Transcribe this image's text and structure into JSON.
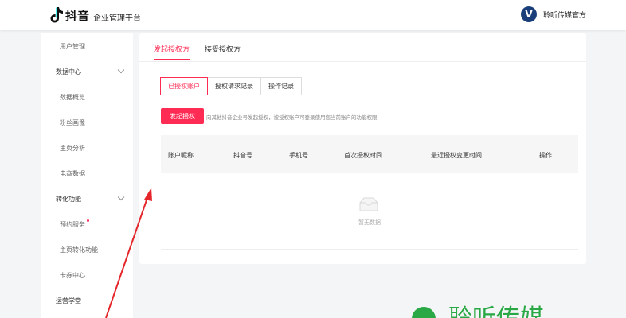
{
  "header": {
    "logo_text": "抖音",
    "subtitle": "企业管理平台",
    "avatar_letter": "V",
    "user_name": "聆听传媒官方"
  },
  "sidebar": {
    "items": [
      {
        "label": "用户管理"
      },
      {
        "label": "数据中心"
      },
      {
        "label": "数据概览"
      },
      {
        "label": "粉丝画像"
      },
      {
        "label": "主页分析"
      },
      {
        "label": "电商数据"
      },
      {
        "label": "转化功能"
      },
      {
        "label": "预约服务"
      },
      {
        "label": "主页转化功能"
      },
      {
        "label": "卡券中心"
      },
      {
        "label": "运营学堂"
      }
    ]
  },
  "main": {
    "tabs": [
      {
        "label": "发起授权方"
      },
      {
        "label": "接受授权方"
      }
    ],
    "segments": [
      {
        "label": "已授权账户"
      },
      {
        "label": "授权请求记录"
      },
      {
        "label": "操作记录"
      }
    ],
    "primary_button": "发起授权",
    "hint": "向其他抖音企业号发起授权，被授权账户可登录使用您当前账户的功能权限",
    "table": {
      "columns": [
        "账户昵称",
        "抖音号",
        "手机号",
        "首次授权时间",
        "最近授权变更时间",
        "操作"
      ],
      "empty_text": "暂无数据"
    }
  },
  "watermark": {
    "text": "聆听传媒"
  },
  "colors": {
    "accent": "#fe2c55",
    "avatar": "#1a3e7a",
    "arrow": "#e5262b",
    "brand_green": "#2aa845"
  }
}
